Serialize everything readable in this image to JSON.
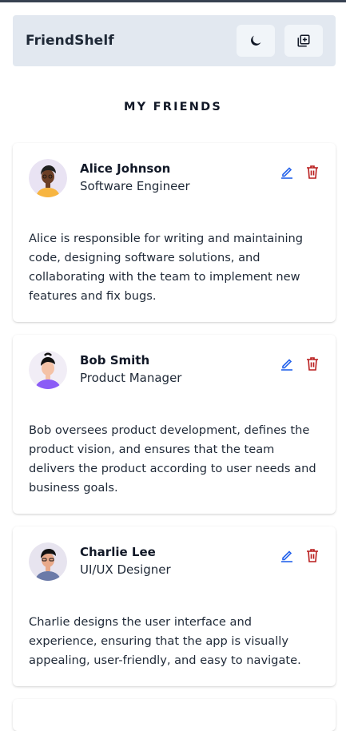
{
  "app": {
    "brand": "FriendShelf",
    "icons": {
      "theme": "moon-icon",
      "add": "add-square-icon"
    }
  },
  "section": {
    "title": "MY FRIENDS"
  },
  "friends": [
    {
      "name": "Alice Johnson",
      "role": "Software Engineer",
      "description": "Alice is responsible for writing and maintaining code, designing software solutions, and collaborating with the team to implement new features and fix bugs."
    },
    {
      "name": "Bob Smith",
      "role": "Product Manager",
      "description": "Bob oversees product development, defines the product vision, and ensures that the team delivers the product according to user needs and business goals."
    },
    {
      "name": "Charlie Lee",
      "role": "UI/UX Designer",
      "description": "Charlie designs the user interface and experience, ensuring that the app is visually appealing, user-friendly, and easy to navigate."
    }
  ],
  "colors": {
    "edit": "#2563eb",
    "delete": "#b91c1c",
    "header_bg": "#e2e8f0"
  }
}
